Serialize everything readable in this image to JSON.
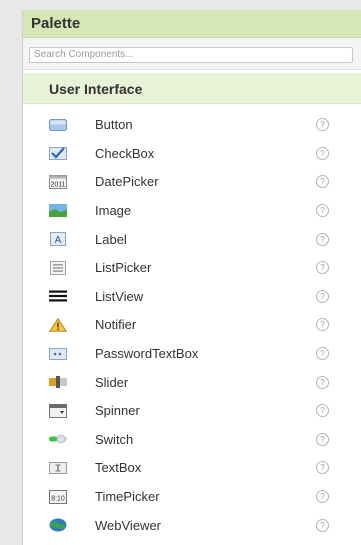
{
  "palette": {
    "title": "Palette",
    "search_placeholder": "Search Components...",
    "category": "User Interface",
    "help_glyph": "?",
    "items": [
      {
        "label": "Button",
        "icon": "button-icon"
      },
      {
        "label": "CheckBox",
        "icon": "checkbox-icon"
      },
      {
        "label": "DatePicker",
        "icon": "datepicker-icon"
      },
      {
        "label": "Image",
        "icon": "image-icon"
      },
      {
        "label": "Label",
        "icon": "label-icon"
      },
      {
        "label": "ListPicker",
        "icon": "listpicker-icon"
      },
      {
        "label": "ListView",
        "icon": "listview-icon"
      },
      {
        "label": "Notifier",
        "icon": "notifier-icon"
      },
      {
        "label": "PasswordTextBox",
        "icon": "passwordtextbox-icon"
      },
      {
        "label": "Slider",
        "icon": "slider-icon"
      },
      {
        "label": "Spinner",
        "icon": "spinner-icon"
      },
      {
        "label": "Switch",
        "icon": "switch-icon"
      },
      {
        "label": "TextBox",
        "icon": "textbox-icon"
      },
      {
        "label": "TimePicker",
        "icon": "timepicker-icon"
      },
      {
        "label": "WebViewer",
        "icon": "webviewer-icon"
      }
    ]
  },
  "colors": {
    "header_bg": "#d6e6b4",
    "category_bg": "#eaf2d8"
  }
}
